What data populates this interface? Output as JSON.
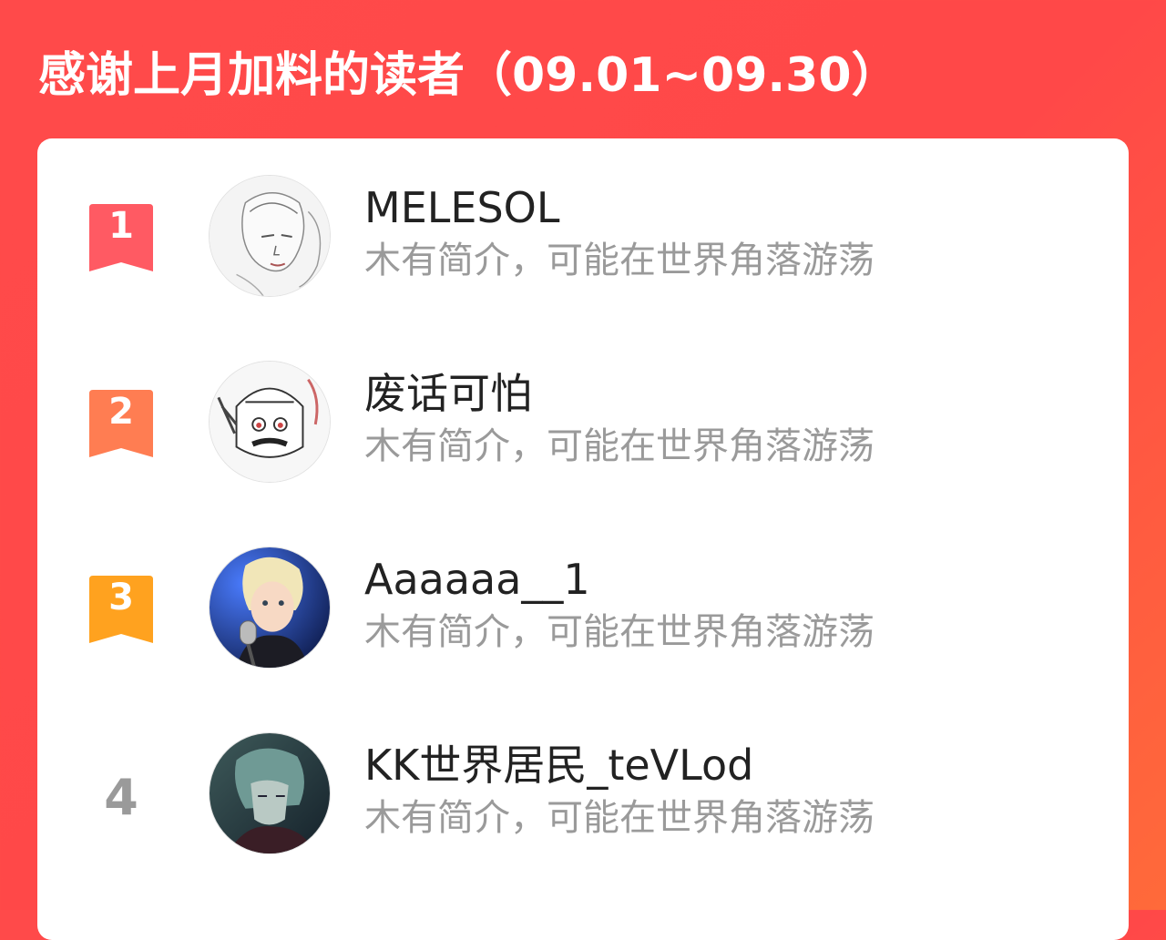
{
  "header": {
    "title": "感谢上月加料的读者（09.01~09.30）"
  },
  "colors": {
    "rank1": "#ff5a63",
    "rank2": "#ff7d52",
    "rank3": "#ffa21f",
    "rank_other": "#9a9a9a"
  },
  "readers": [
    {
      "rank": "1",
      "name": "MELESOL",
      "bio": "木有简介，可能在世界角落游荡",
      "avatar_icon": "sketch-portrait-avatar"
    },
    {
      "rank": "2",
      "name": "废话可怕",
      "bio": "木有简介，可能在世界角落游荡",
      "avatar_icon": "cartoon-character-avatar"
    },
    {
      "rank": "3",
      "name": "Aaaaaa__1",
      "bio": "木有简介，可能在世界角落游荡",
      "avatar_icon": "singer-with-microphone-avatar"
    },
    {
      "rank": "4",
      "name": "KK世界居民_teVLod",
      "bio": "木有简介，可能在世界角落游荡",
      "avatar_icon": "anime-character-avatar"
    }
  ]
}
